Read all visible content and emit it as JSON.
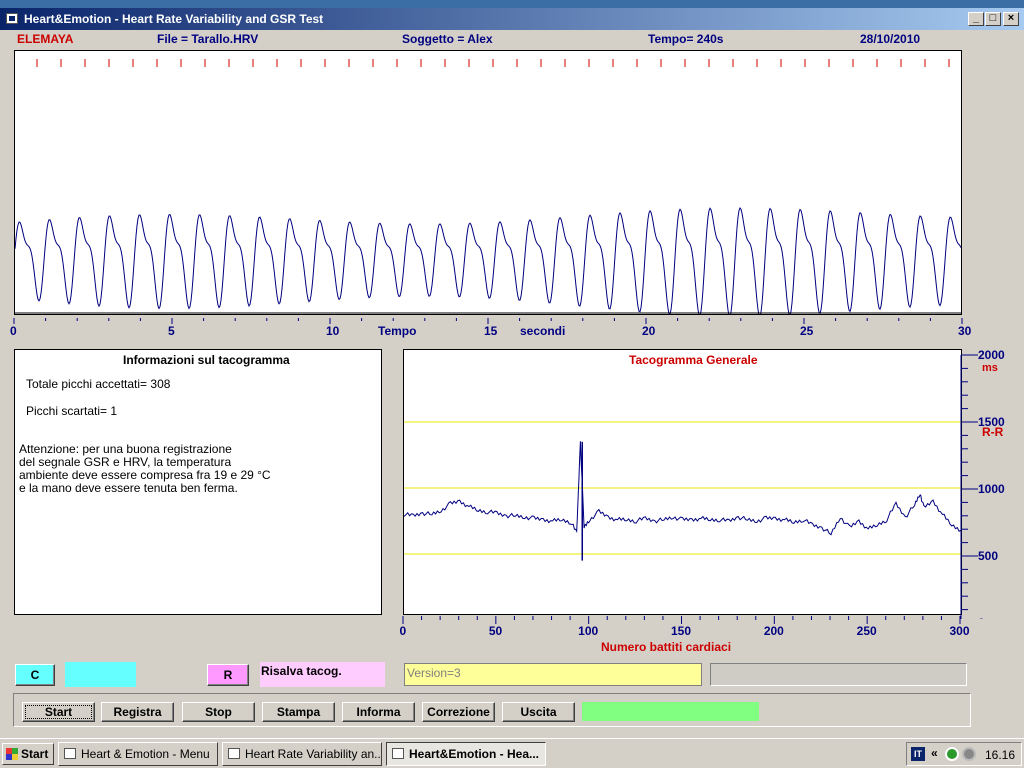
{
  "window": {
    "title": "Heart&Emotion -  Heart Rate Variability and GSR Test",
    "minimize_glyph": "_",
    "maximize_glyph": "□",
    "close_glyph": "×"
  },
  "header": {
    "brand": "ELEMAYA",
    "file": "File  = Tarallo.HRV",
    "subject": "Soggetto = Alex",
    "time": "Tempo=  240s",
    "date": "28/10/2010"
  },
  "waveform_axis": {
    "ticks": [
      "0",
      "5",
      "10",
      "15",
      "20",
      "25",
      "30"
    ],
    "label_time": "Tempo",
    "label_seconds": "secondi"
  },
  "info_panel": {
    "title": "Informazioni sul tacogramma",
    "accepted": "Totale picchi accettati= 308",
    "rejected": "Picchi scartati= 1",
    "warning": [
      "Attenzione: per una buona registrazione",
      "del segnale GSR e HRV, la temperatura",
      "ambiente deve essere compresa fra 19 e 29 °C",
      "e la mano deve essere tenuta ben ferma."
    ]
  },
  "chart_data": [
    {
      "type": "line",
      "title": "",
      "xlabel": "Tempo secondi",
      "xlim": [
        0,
        30
      ],
      "xticks": [
        0,
        5,
        10,
        15,
        20,
        25,
        30
      ],
      "description_series": "waveform",
      "series": [
        {
          "peaks_per_second": 1.05,
          "color": "#000080"
        }
      ]
    },
    {
      "type": "line",
      "title": "Tacogramma Generale",
      "xlabel": "Numero battiti cardiaci",
      "ylabel_unit": "ms",
      "ylabel": "R-R",
      "xlim": [
        0,
        300
      ],
      "ylim": [
        0,
        2000
      ],
      "xticks": [
        0,
        50,
        100,
        150,
        200,
        250,
        300
      ],
      "yticks": [
        0,
        500,
        1000,
        1500,
        2000
      ],
      "reference_lines": [
        1500,
        1000,
        500
      ],
      "series": [
        {
          "x": [
            0,
            5,
            10,
            15,
            20,
            25,
            30,
            35,
            40,
            45,
            50,
            55,
            60,
            65,
            70,
            75,
            80,
            85,
            90,
            93,
            95,
            97,
            100,
            105,
            110,
            115,
            120,
            125,
            130,
            135,
            140,
            145,
            150,
            155,
            160,
            165,
            170,
            175,
            180,
            185,
            190,
            195,
            200,
            205,
            210,
            215,
            220,
            225,
            230,
            235,
            240,
            245,
            250,
            255,
            260,
            265,
            270,
            275,
            278,
            280,
            285,
            290,
            295,
            300
          ],
          "y": [
            800,
            790,
            810,
            800,
            830,
            880,
            900,
            860,
            830,
            820,
            810,
            790,
            790,
            780,
            770,
            760,
            750,
            760,
            740,
            660,
            1350,
            700,
            760,
            820,
            780,
            760,
            760,
            750,
            770,
            750,
            760,
            780,
            760,
            760,
            770,
            760,
            760,
            750,
            780,
            760,
            750,
            770,
            770,
            760,
            740,
            760,
            720,
            700,
            650,
            780,
            700,
            750,
            690,
            720,
            760,
            880,
            780,
            870,
            960,
            850,
            900,
            800,
            720,
            680
          ],
          "color": "#000080"
        }
      ]
    }
  ],
  "tacho_labels": {
    "title": "Tacogramma Generale",
    "xlabel": "Numero battiti cardiaci",
    "unit": "ms",
    "ylabel": "R-R",
    "xticks": [
      "0",
      "50",
      "100",
      "150",
      "200",
      "250",
      "300"
    ],
    "yticks": [
      "2000",
      "1500",
      "1000",
      "500",
      "0"
    ]
  },
  "controls": {
    "c_label": "C",
    "r_label": "R",
    "risalva_label": "Risalva tacog.",
    "version": "Version=3",
    "colors": {
      "cyan": "#66ffff",
      "pink": "#ff99ff",
      "pink_light": "#ffccff",
      "yellow": "#ffff99",
      "green": "#80ff80"
    }
  },
  "buttons": {
    "start": "Start",
    "registra": "Registra",
    "stop": "Stop",
    "stampa": "Stampa",
    "informa": "Informa",
    "correzione": "Correzione",
    "uscita": "Uscita"
  },
  "taskbar": {
    "start": "Start",
    "tasks": [
      "Heart & Emotion - Menu",
      "Heart Rate Variability an...",
      "Heart&Emotion -  Hea..."
    ],
    "lang": "IT",
    "chevron": "«",
    "clock": "16.16"
  }
}
